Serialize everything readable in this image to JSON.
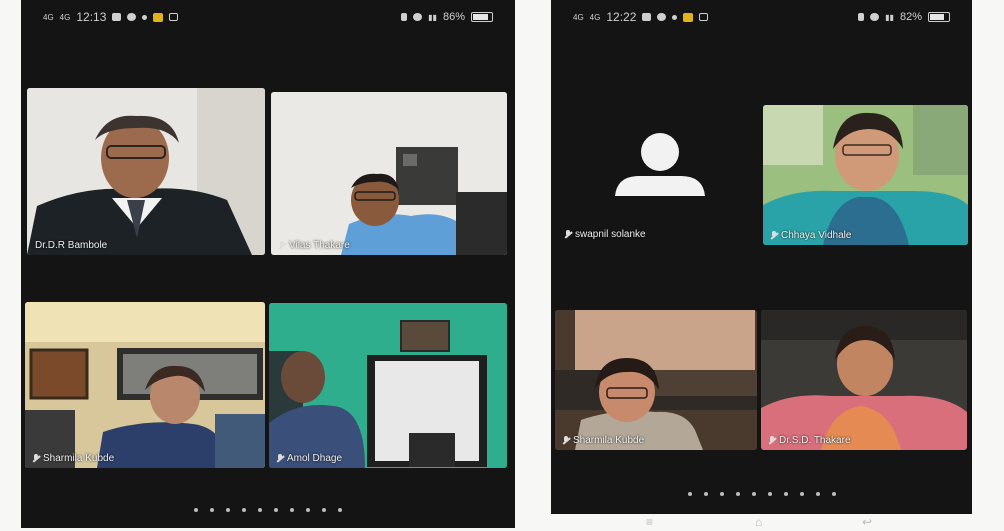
{
  "left_screen": {
    "status": {
      "signal": "4G",
      "signal2": "4G",
      "time": "12:13",
      "battery": "86%"
    },
    "tiles": [
      {
        "name": "Dr.D.R Bambole",
        "mic": false
      },
      {
        "name": "Vilas Thakare",
        "mic": true
      },
      {
        "name": "Sharmila Kubde",
        "mic": true
      },
      {
        "name": "Amol Dhage",
        "mic": true
      }
    ],
    "page_dots": 10
  },
  "right_screen": {
    "status": {
      "signal": "4G",
      "signal2": "4G",
      "time": "12:22",
      "battery": "82%"
    },
    "tiles": [
      {
        "name": "swapnil solanke",
        "mic": true
      },
      {
        "name": "Chhaya Vidhale",
        "mic": true
      },
      {
        "name": "Sharmila Kubde",
        "mic": true
      },
      {
        "name": "Dr.S.D. Thakare",
        "mic": true
      }
    ],
    "page_dots": 10
  }
}
